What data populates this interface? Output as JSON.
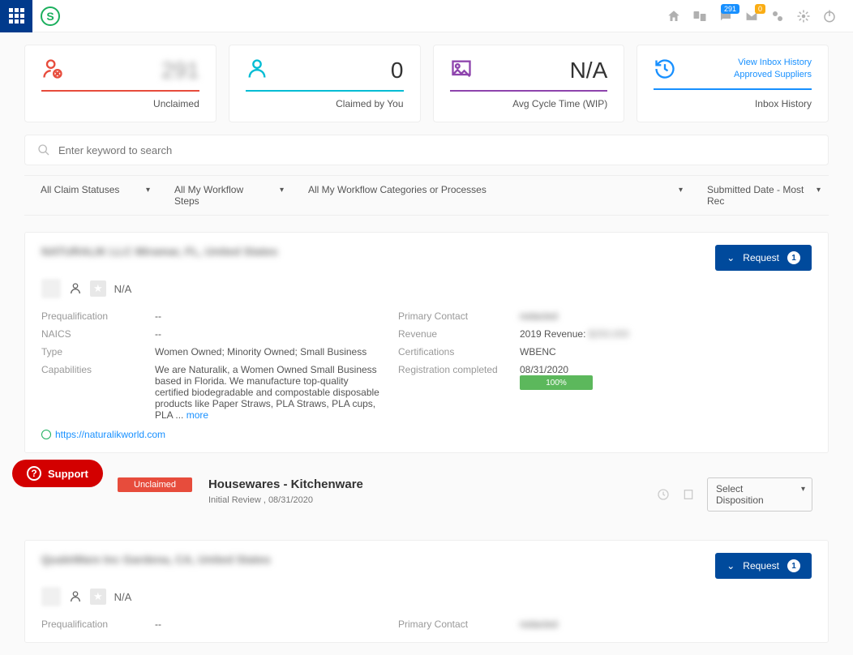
{
  "top": {
    "badges": {
      "msg": "291",
      "env": "0"
    }
  },
  "cards": {
    "unclaimed": {
      "value": "291",
      "title": "Unclaimed"
    },
    "claimed": {
      "value": "0",
      "title": "Claimed by You"
    },
    "cycle": {
      "value": "N/A",
      "title": "Avg Cycle Time (WIP)"
    },
    "history": {
      "title": "Inbox History",
      "link1": "View Inbox History",
      "link2": "Approved Suppliers"
    }
  },
  "search": {
    "placeholder": "Enter keyword to search"
  },
  "filters": {
    "claim": "All Claim Statuses",
    "steps": "All My Workflow Steps",
    "cats": "All My Workflow Categories or Processes",
    "sort": "Submitted Date - Most Rec"
  },
  "supplier1": {
    "name": "NATURALIK LLC Miramar, FL, United States",
    "rating": "N/A",
    "request_label": "Request",
    "request_count": "1",
    "labels": {
      "prequal": "Prequalification",
      "naics": "NAICS",
      "type": "Type",
      "cap": "Capabilities",
      "contact": "Primary Contact",
      "revenue": "Revenue",
      "cert": "Certifications",
      "reg": "Registration completed"
    },
    "vals": {
      "prequal": "--",
      "naics": "--",
      "type": "Women Owned; Minority Owned; Small Business",
      "cap": "We are Naturalik, a Women Owned Small Business based in Florida. We manufacture top-quality certified biodegradable and compostable disposable products like Paper Straws, PLA Straws, PLA cups, PLA ...",
      "more": "more",
      "contact": "redacted",
      "revenue_prefix": "2019 Revenue:",
      "revenue_amt": "$250,000",
      "cert": "WBENC",
      "reg": "08/31/2020",
      "progress": "100%"
    },
    "url": "https://naturalikworld.com"
  },
  "workflow": {
    "claim": "Unclaimed",
    "title": "Housewares - Kitchenware",
    "sub": "Initial Review , 08/31/2020",
    "disposition": "Select Disposition"
  },
  "supplier2": {
    "name": "QualeWare Inc Gardena, CA, United States",
    "rating": "N/A",
    "request_label": "Request",
    "request_count": "1",
    "prequal_lbl": "Prequalification",
    "prequal_val": "--",
    "contact_lbl": "Primary Contact",
    "contact_val": "redacted"
  },
  "support": "Support"
}
